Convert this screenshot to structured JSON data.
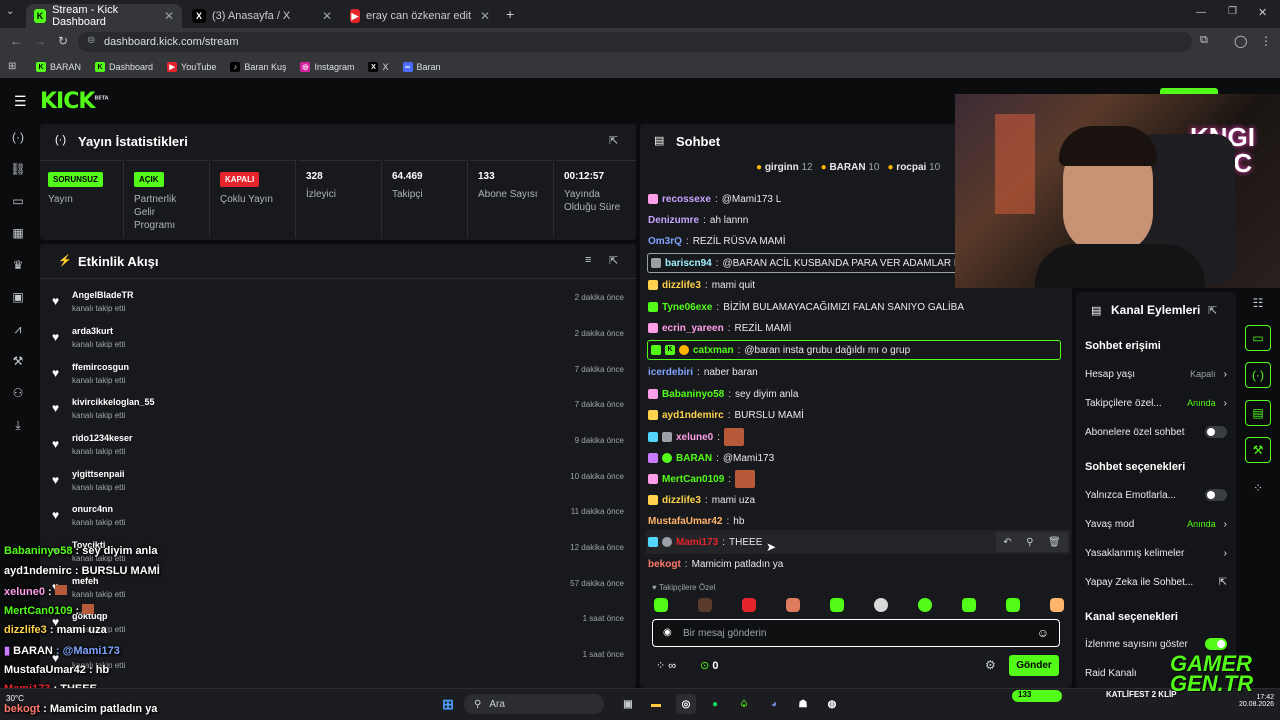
{
  "browser": {
    "tabs": [
      {
        "title": "Stream - Kick Dashboard",
        "active": true
      },
      {
        "title": "(3) Anasayfa / X",
        "active": false
      },
      {
        "title": "eray can özkenar edit #teampe",
        "active": false
      }
    ],
    "url": "dashboard.kick.com/stream",
    "bookmarks": [
      "BARAN",
      "Dashboard",
      "YouTube",
      "Baran Kuş",
      "Instagram",
      "X",
      "Baran"
    ]
  },
  "stats": {
    "title": "Yayın İstatistikleri",
    "items": [
      {
        "badge": "SORUNSUZ",
        "label": "Yayın",
        "color": "#53fc18"
      },
      {
        "badge": "AÇIK",
        "label": "Partnerlik Gelir Programı",
        "color": "#53fc18"
      },
      {
        "badge": "KAPALI",
        "label": "Çoklu Yayın",
        "color": "#e5242b"
      },
      {
        "value": "328",
        "label": "İzleyici"
      },
      {
        "value": "64.469",
        "label": "Takipçi"
      },
      {
        "value": "133",
        "label": "Abone Sayısı"
      },
      {
        "value": "00:12:57",
        "label": "Yayında Olduğu Süre"
      }
    ]
  },
  "activity": {
    "title": "Etkinlik Akışı",
    "items": [
      {
        "name": "AngelBladeTR",
        "action": "kanalı takip etti",
        "time": "2 dakika önce"
      },
      {
        "name": "arda3kurt",
        "action": "kanalı takip etti",
        "time": "2 dakika önce"
      },
      {
        "name": "ffemircosgun",
        "action": "kanalı takip etti",
        "time": "7 dakika önce"
      },
      {
        "name": "kivircikkeloglan_55",
        "action": "kanalı takip etti",
        "time": "7 dakika önce"
      },
      {
        "name": "rido1234keser",
        "action": "kanalı takip etti",
        "time": "9 dakika önce"
      },
      {
        "name": "yigittsenpaii",
        "action": "kanalı takip etti",
        "time": "10 dakika önce"
      },
      {
        "name": "onurc4nn",
        "action": "kanalı takip etti",
        "time": "11 dakika önce"
      },
      {
        "name": "Toycikti",
        "action": "kanalı takip etti",
        "time": "12 dakika önce"
      },
      {
        "name": "mefeh",
        "action": "kanalı takip etti",
        "time": "57 dakika önce"
      },
      {
        "name": "göktuqp",
        "action": "kanalı takip etti",
        "time": "1 saat önce"
      },
      {
        "name": "",
        "action": "kanalı takip etti",
        "time": "1 saat önce"
      }
    ]
  },
  "chat": {
    "title": "Sohbet",
    "top_gifters": [
      {
        "name": "girginn",
        "count": "12"
      },
      {
        "name": "BARAN",
        "count": "10"
      },
      {
        "name": "rocpai",
        "count": "10"
      }
    ],
    "messages": [
      {
        "user": "recossexe",
        "text": "@Mami173 L",
        "color": "#c7a4ff"
      },
      {
        "user": "Denizumre",
        "text": "ah lannn",
        "color": "#c7a4ff"
      },
      {
        "user": "Om3rQ",
        "text": "REZİL RÜSVA MAMİ",
        "color": "#7fa4ff"
      },
      {
        "user": "bariscn94",
        "text": "@BARAN ACİL KUSBANDA PARA VER ADAMLAR BUL",
        "color": "#9ef0ff",
        "highlight": true
      },
      {
        "user": "dizzlife3",
        "text": "mami quit",
        "color": "#ffd34d"
      },
      {
        "user": "Tyne06exe",
        "text": "BİZİM BULAMAYACAĞIMIZI FALAN SANIYO GALİBA",
        "color": "#53fc18"
      },
      {
        "user": "ecrin_yareen",
        "text": "REZİL MAMİ",
        "color": "#ff9ee8"
      },
      {
        "user": "catxman",
        "text": "@baran insta grubu dağıldı mı o grup",
        "color": "#53fc18",
        "highlight": true
      },
      {
        "user": "icerdebiri",
        "text": "naber baran",
        "color": "#7fa4ff"
      },
      {
        "user": "Babaninyo58",
        "text": "sey diyim anla",
        "color": "#53fc18"
      },
      {
        "user": "ayd1ndemirc",
        "text": "BURSLU MAMİ",
        "color": "#ffd34d"
      },
      {
        "user": "xelune0",
        "text": "",
        "color": "#ff9ee8"
      },
      {
        "user": "BARAN",
        "text": "@Mami173",
        "color": "#53fc18"
      },
      {
        "user": "MertCan0109",
        "text": "",
        "color": "#53fc18"
      },
      {
        "user": "dizzlife3",
        "text": "mami uza",
        "color": "#ffd34d"
      },
      {
        "user": "MustafaUmar42",
        "text": "hb",
        "color": "#ffb36b"
      },
      {
        "user": "Mami173",
        "text": "THEEE",
        "color": "#e5242b"
      },
      {
        "user": "bekogt",
        "text": "Mamicim patladın ya",
        "color": "#ff7a6b"
      }
    ],
    "followers_only": "Takipçilere Özel",
    "input_placeholder": "Bir mesaj gönderin",
    "viewers_icon": "∞",
    "points": "0",
    "send": "Gönder"
  },
  "channel_actions": {
    "title": "Kanal Eylemleri",
    "chat_access": "Sohbet erişimi",
    "rows_access": [
      {
        "label": "Hesap yaşı",
        "value": "Kapalı"
      },
      {
        "label": "Takipçilere özel...",
        "value": "Anında"
      },
      {
        "label": "Abonelere özel sohbet",
        "toggle": false
      }
    ],
    "chat_options": "Sohbet seçenekleri",
    "rows_options": [
      {
        "label": "Yalnızca Emotlarla...",
        "toggle": false
      },
      {
        "label": "Yavaş mod",
        "value": "Anında"
      },
      {
        "label": "Yasaklanmış kelimeler"
      },
      {
        "label": "Yapay Zeka ile Sohbet..."
      }
    ],
    "channel_options": "Kanal seçenekleri",
    "rows_channel": [
      {
        "label": "İzlenme sayısını göster",
        "toggle": true
      },
      {
        "label": "Raid Kanalı"
      }
    ]
  },
  "overlay_chat": [
    {
      "user": "Babaninyo58",
      "text": " : sey diyim anla",
      "color": "#53fc18"
    },
    {
      "user": "ayd1ndemirc",
      "text": " : BURSLU MAMİ",
      "color": "#ffffff"
    },
    {
      "user": "xelune0",
      "text": " : ",
      "color": "#ff9ee8"
    },
    {
      "user": "MertCan0109",
      "text": " : ",
      "color": "#53fc18"
    },
    {
      "user": "dizzlife3",
      "text": " : mami uza",
      "color": "#ffd34d"
    },
    {
      "user": "BARAN",
      "text": " : @Mami173",
      "color": "#ffffff"
    },
    {
      "user": "MustafaUmar42",
      "text": " : hb",
      "color": "#ffffff"
    },
    {
      "user": "Mami173",
      "text": " : THEEE",
      "color": "#e5242b"
    },
    {
      "user": "bekogt",
      "text": " : Mamicim patladın ya",
      "color": "#ff7a6b"
    }
  ],
  "taskbar": {
    "search": "Ara",
    "weather": "30°C",
    "overlay_counter": "133",
    "overlay_title": "KATLİFEST 2 KLİP",
    "time": "17:42",
    "date": "20.08.2026"
  },
  "watermark": "GAMER GEN.TR"
}
